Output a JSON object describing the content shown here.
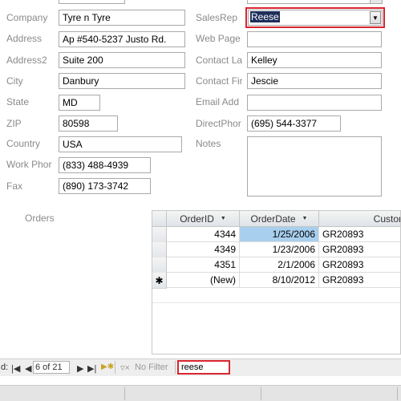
{
  "left_fields": [
    {
      "label": "Company",
      "value": "Tyre n Tyre"
    },
    {
      "label": "Address",
      "value": "Ap #540-5237 Justo Rd."
    },
    {
      "label": "Address2",
      "value": "Suite 200"
    },
    {
      "label": "City",
      "value": "Danbury"
    },
    {
      "label": "State",
      "value": "MD"
    },
    {
      "label": "ZIP",
      "value": "80598"
    },
    {
      "label": "Country",
      "value": "USA"
    },
    {
      "label": "Work Phor",
      "value": "(833) 488-4939"
    },
    {
      "label": "Fax",
      "value": "(890) 173-3742"
    }
  ],
  "right_fields": {
    "salesrep": {
      "label": "SalesRep",
      "value": "Reese"
    },
    "webpage": {
      "label": "Web Page",
      "value": ""
    },
    "contact_last": {
      "label": "Contact La",
      "value": "Kelley"
    },
    "contact_first": {
      "label": "Contact Fir",
      "value": "Jescie"
    },
    "email": {
      "label": "Email Add",
      "value": ""
    },
    "direct_phone": {
      "label": "DirectPhor",
      "value": "(695) 544-3377"
    },
    "notes": {
      "label": "Notes",
      "value": ""
    }
  },
  "orders": {
    "label": "Orders",
    "columns": [
      "OrderID",
      "OrderDate",
      "Custom"
    ],
    "rows": [
      {
        "selector": "",
        "order_id": "4344",
        "order_date": "1/25/2006",
        "customer": "GR20893"
      },
      {
        "selector": "",
        "order_id": "4349",
        "order_date": "1/23/2006",
        "customer": "GR20893"
      },
      {
        "selector": "",
        "order_id": "4351",
        "order_date": "2/1/2006",
        "customer": "GR20893"
      },
      {
        "selector": "✱",
        "order_id": "(New)",
        "order_date": "8/10/2012",
        "customer": "GR20893"
      }
    ]
  },
  "navigation": {
    "record_prefix": "d:",
    "record_position": "6 of 21",
    "filter_label": "No Filter",
    "search_value": "reese"
  },
  "colors": {
    "highlight": "#d9262f",
    "selected_text_bg": "#1f2f5a",
    "current_cell": "#a8cfee"
  }
}
